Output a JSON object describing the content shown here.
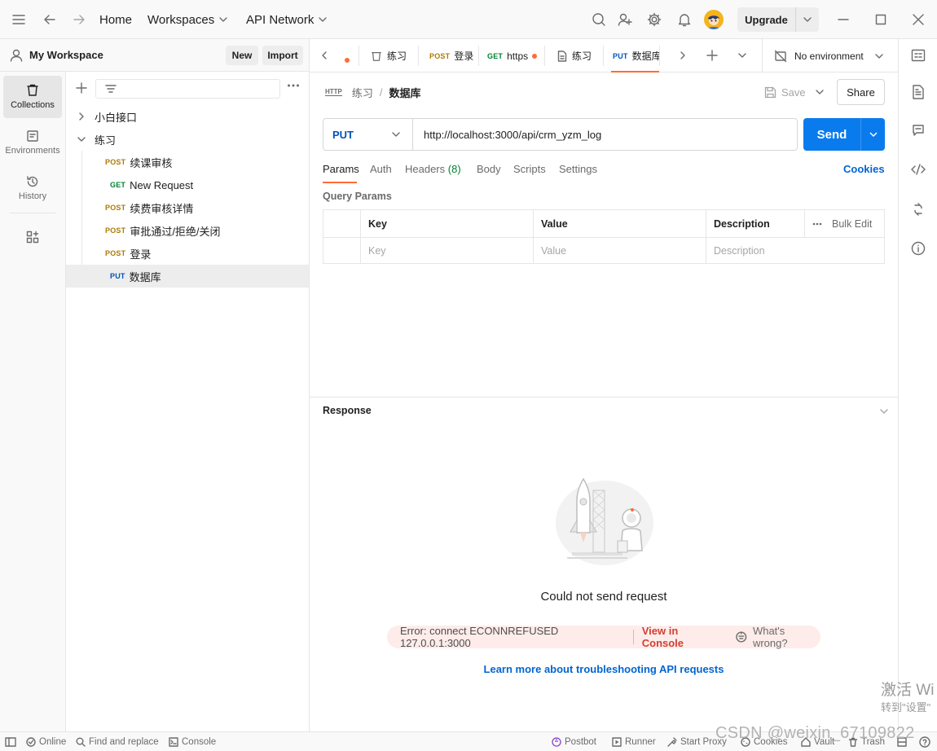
{
  "topbar": {
    "home": "Home",
    "workspaces": "Workspaces",
    "api_network": "API Network",
    "upgrade": "Upgrade"
  },
  "workspace": {
    "name": "My Workspace",
    "new_label": "New",
    "import_label": "Import"
  },
  "rail": {
    "collections": "Collections",
    "environments": "Environments",
    "history": "History"
  },
  "tree": {
    "folders": [
      {
        "name": "小白接口",
        "expanded": false
      },
      {
        "name": "练习",
        "expanded": true
      }
    ],
    "requests": [
      {
        "method": "POST",
        "name": "续课审核"
      },
      {
        "method": "GET",
        "name": "New Request"
      },
      {
        "method": "POST",
        "name": "续费审核详情"
      },
      {
        "method": "POST",
        "name": "审批通过/拒绝/关闭"
      },
      {
        "method": "POST",
        "name": "登录"
      },
      {
        "method": "PUT",
        "name": "数据库"
      }
    ]
  },
  "tabs": [
    {
      "method": "",
      "name": "练习",
      "icon": "collection-icon"
    },
    {
      "method": "POST",
      "name": "登录"
    },
    {
      "method": "GET",
      "name": "https",
      "unsaved": true
    },
    {
      "method": "",
      "name": "练习",
      "icon": "document-icon"
    },
    {
      "method": "PUT",
      "name": "数据库",
      "active": true
    }
  ],
  "environment": "No environment",
  "breadcrumb": {
    "badge": "HTTP",
    "parent": "练习",
    "separator": "/",
    "current": "数据库"
  },
  "actions": {
    "save": "Save",
    "share": "Share"
  },
  "request": {
    "method": "PUT",
    "url": "http://localhost:3000/api/crm_yzm_log",
    "send": "Send"
  },
  "request_tabs": {
    "params": "Params",
    "auth": "Auth",
    "headers": "Headers",
    "headers_count": "(8)",
    "body": "Body",
    "scripts": "Scripts",
    "settings": "Settings",
    "cookies": "Cookies"
  },
  "query_params": {
    "title": "Query Params",
    "columns": [
      "Key",
      "Value",
      "Description"
    ],
    "bulk_edit": "Bulk Edit",
    "placeholders": [
      "Key",
      "Value",
      "Description"
    ]
  },
  "response": {
    "title": "Response",
    "message": "Could not send request",
    "error": "Error: connect ECONNREFUSED 127.0.0.1:3000",
    "view_console": "View in Console",
    "whats_wrong": "What's wrong?",
    "learn_more": "Learn more about troubleshooting API requests"
  },
  "footer": {
    "online": "Online",
    "find_replace": "Find and replace",
    "console": "Console",
    "postbot": "Postbot",
    "runner": "Runner",
    "start_proxy": "Start Proxy",
    "cookies": "Cookies",
    "vault": "Vault",
    "trash": "Trash"
  },
  "watermark": {
    "activate_line1": "激活 Wi",
    "activate_line2": "转到\"设置\"",
    "csdn": "CSDN @weixin_67109822"
  },
  "colors": {
    "accent": "#ff6c37",
    "send_blue": "#097bed",
    "put": "#0053b8",
    "post": "#ad7a03",
    "get": "#007f31",
    "error_red": "#d23f31"
  }
}
